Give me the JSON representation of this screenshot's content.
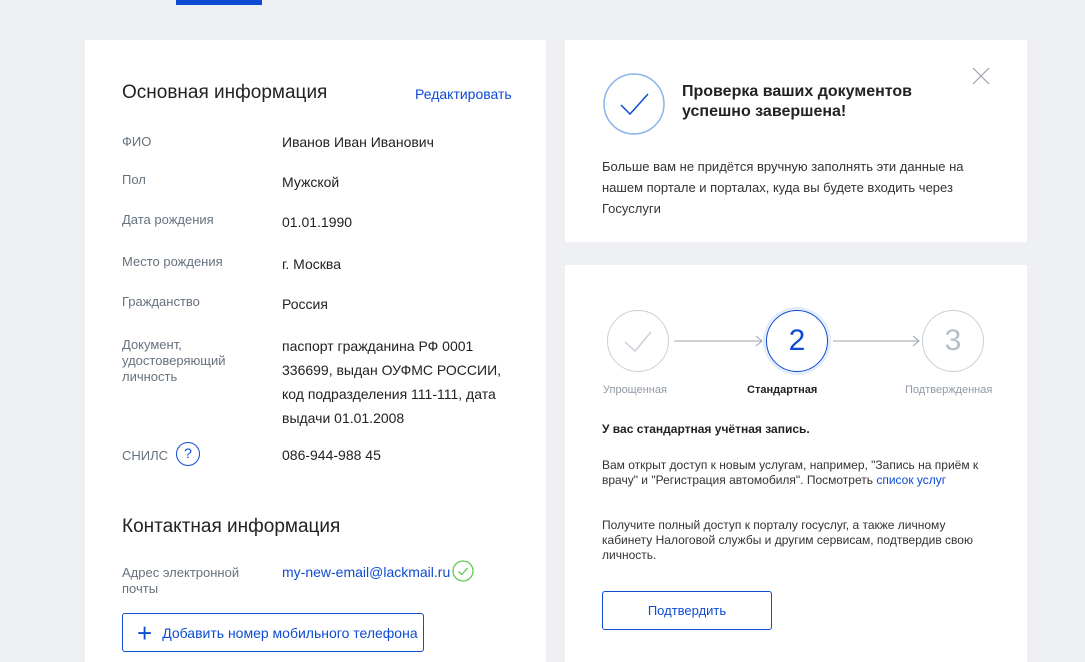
{
  "colors": {
    "accent": "#0d4cd3",
    "success": "#5fc84f",
    "background": "#eef0f3"
  },
  "basic_info": {
    "title": "Основная информация",
    "edit_label": "Редактировать",
    "fields": [
      {
        "label": "ФИО",
        "value": "Иванов Иван Иванович"
      },
      {
        "label": "Пол",
        "value": "Мужской"
      },
      {
        "label": "Дата рождения",
        "value": "01.01.1990"
      },
      {
        "label": "Место рождения",
        "value": "г. Москва"
      },
      {
        "label": "Гражданство",
        "value": "Россия"
      },
      {
        "label": "Документ, удостоверяющий личность",
        "value": "паспорт гражданина РФ 0001 336699, выдан ОУФМС РОССИИ, код подразделения 111-111, дата выдачи 01.01.2008"
      },
      {
        "label": "СНИЛС",
        "value": "086-944-988 45",
        "help_icon": "question-icon"
      }
    ]
  },
  "contact_info": {
    "title": "Контактная информация",
    "email_label": "Адрес электронной почты",
    "email_value": "my-new-email@lackmail.ru",
    "email_status_icon": "verified-check-icon",
    "add_phone_label": "Добавить номер мобильного телефона"
  },
  "success_notice": {
    "title": "Проверка ваших документов успешно завершена!",
    "text": "Больше вам не придётся вручную заполнять эти данные на нашем портале и порталах, куда вы будете входить через Госуслуги"
  },
  "account_level": {
    "steps": [
      {
        "number": "",
        "label": "Упрощенная",
        "state": "done"
      },
      {
        "number": "2",
        "label": "Стандартная",
        "state": "current"
      },
      {
        "number": "3",
        "label": "Подтвержденная",
        "state": "pending"
      }
    ],
    "heading": "У вас стандартная учётная запись.",
    "text1": "Вам открыт доступ к новым услугам, например, \"Запись на приём к врачу\" и \"Регистрация автомобиля\". Посмотреть",
    "services_link": "список услуг",
    "text2": "Получите полный доступ к порталу госуслуг, а также личному кабинету Налоговой службы и другим сервисам, подтвердив свою личность.",
    "confirm_label": "Подтвердить"
  }
}
